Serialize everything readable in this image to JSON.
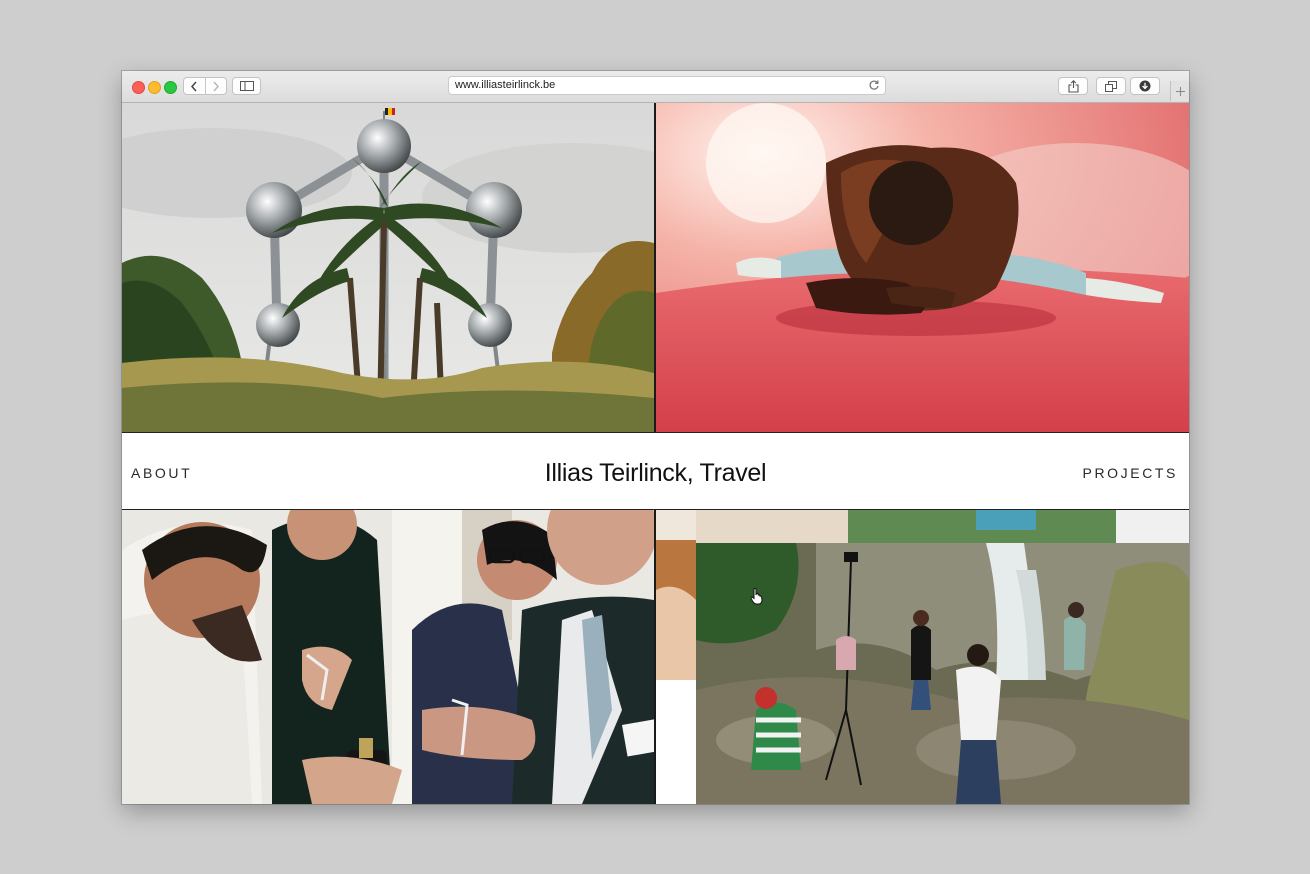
{
  "browser": {
    "url": "www.illiasteirlinck.be",
    "icons": {
      "back": "chevron-left-icon",
      "forward": "chevron-right-icon",
      "sidebar": "sidebar-icon",
      "reload": "reload-icon",
      "share": "share-icon",
      "tabs": "tabs-icon",
      "downloads": "download-icon",
      "new_tab": "plus-icon"
    }
  },
  "site": {
    "title": "Illias Teirlinck, Travel",
    "nav": {
      "about": "ABOUT",
      "projects": "PROJECTS"
    }
  },
  "colors": {
    "traffic_red": "#fc5f57",
    "traffic_yellow": "#fdbc2e",
    "traffic_green": "#28c840",
    "page_background": "#cecece"
  }
}
